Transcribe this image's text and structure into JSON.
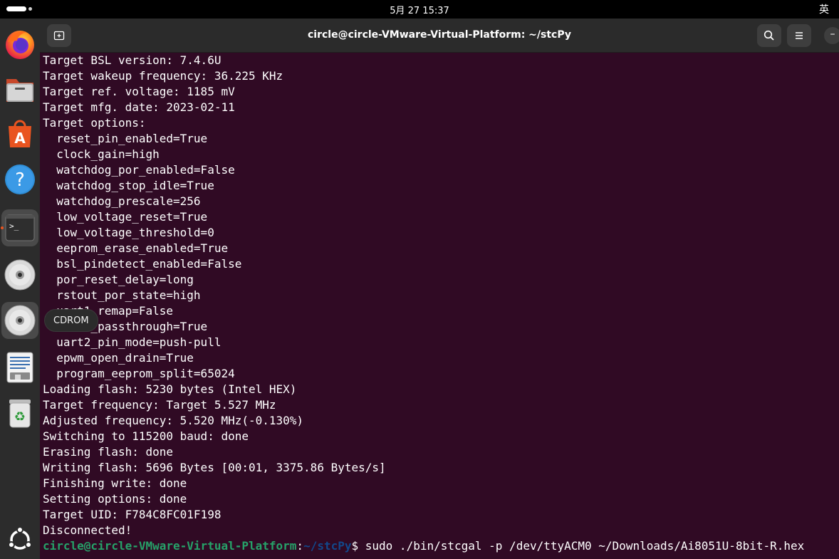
{
  "topbar": {
    "clock": "5月 27  15:37",
    "input_method": "英"
  },
  "dock": {
    "items": [
      {
        "icon": "firefox-icon"
      },
      {
        "icon": "files-icon"
      },
      {
        "icon": "app-center-icon"
      },
      {
        "icon": "help-icon"
      },
      {
        "icon": "terminal-icon"
      },
      {
        "icon": "cdrom-icon"
      },
      {
        "icon": "cdrom-icon"
      },
      {
        "icon": "text-editor-icon"
      },
      {
        "icon": "trash-icon"
      },
      {
        "icon": "ubuntu-apps-icon"
      }
    ],
    "tooltip": "CDROM"
  },
  "window": {
    "title": "circle@circle-VMware-Virtual-Platform: ~/stcPy",
    "minimize_glyph": "–"
  },
  "terminal": {
    "lines": [
      "Target BSL version: 7.4.6U",
      "Target wakeup frequency: 36.225 KHz",
      "Target ref. voltage: 1185 mV",
      "Target mfg. date: 2023-02-11",
      "Target options:",
      "  reset_pin_enabled=True",
      "  clock_gain=high",
      "  watchdog_por_enabled=False",
      "  watchdog_stop_idle=True",
      "  watchdog_prescale=256",
      "  low_voltage_reset=True",
      "  low_voltage_threshold=0",
      "  eeprom_erase_enabled=True",
      "  bsl_pindetect_enabled=False",
      "  por_reset_delay=long",
      "  rstout_por_state=high",
      "  uart1_remap=False",
      "  uart2_passthrough=True",
      "  uart2_pin_mode=push-pull",
      "  epwm_open_drain=True",
      "  program_eeprom_split=65024",
      "Loading flash: 5230 bytes (Intel HEX)",
      "Target frequency: Target 5.527 MHz",
      "Adjusted frequency: 5.520 MHz(-0.130%)",
      "Switching to 115200 baud: done",
      "Erasing flash: done",
      "Writing flash: 5696 Bytes [00:01, 3375.86 Bytes/s]",
      "Finishing write: done",
      "Setting options: done",
      "Target UID: F784C8FC01F198",
      "Disconnected!"
    ],
    "prompt": {
      "user_host": "circle@circle-VMware-Virtual-Platform",
      "colon": ":",
      "path": "~/stcPy",
      "symbol": "$ ",
      "command": "sudo ./bin/stcgal -p /dev/ttyACM0 ~/Downloads/Ai8051U-8bit-R.hex"
    }
  }
}
